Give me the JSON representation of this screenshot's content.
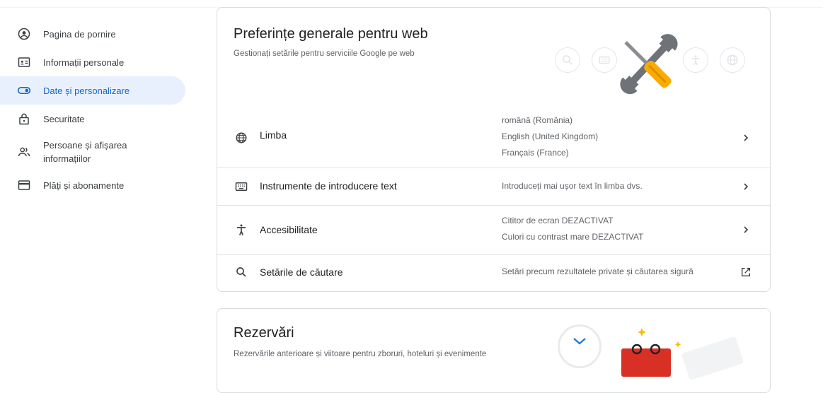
{
  "sidebar": {
    "items": [
      {
        "label": "Pagina de pornire",
        "icon": "account-circle-icon"
      },
      {
        "label": "Informații personale",
        "icon": "id-card-icon"
      },
      {
        "label": "Date și personalizare",
        "icon": "toggle-icon",
        "active": true
      },
      {
        "label": "Securitate",
        "icon": "lock-icon"
      },
      {
        "label": "Persoane și afișarea informațiilor",
        "icon": "people-icon"
      },
      {
        "label": "Plăți și abonamente",
        "icon": "credit-card-icon"
      }
    ]
  },
  "web_prefs": {
    "title": "Preferințe generale pentru web",
    "description": "Gestionați setările pentru serviciile Google pe web",
    "rows": {
      "language": {
        "label": "Limba",
        "values": [
          "română (România)",
          "English (United Kingdom)",
          "Français (France)"
        ]
      },
      "input_tools": {
        "label": "Instrumente de introducere text",
        "values": [
          "Introduceți mai ușor text în limba dvs."
        ]
      },
      "accessibility": {
        "label": "Accesibilitate",
        "values": [
          "Cititor de ecran DEZACTIVAT",
          "Culori cu contrast mare DEZACTIVAT"
        ]
      },
      "search_settings": {
        "label": "Setările de căutare",
        "values": [
          "Setări precum rezultatele private și căutarea sigură"
        ]
      }
    }
  },
  "reservations": {
    "title": "Rezervări",
    "description": "Rezervările anterioare și viitoare pentru zboruri, hoteluri și evenimente"
  },
  "colors": {
    "accent": "#1967d2",
    "active_bg": "#e8f0fe",
    "icon_grey": "#5f6368",
    "tool_yellow": "#f9ab00",
    "tool_grey": "#6f7378",
    "calendar_red": "#d93025"
  }
}
